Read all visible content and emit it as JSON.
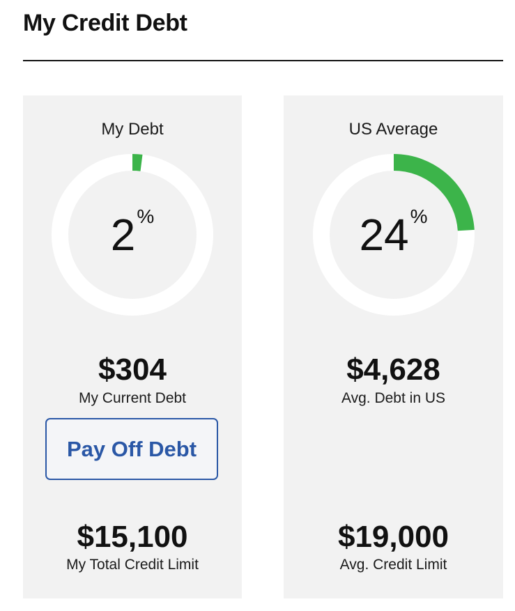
{
  "page": {
    "title": "My Credit Debt"
  },
  "colors": {
    "ring_track": "#ffffff",
    "ring_fill": "#3cb44a",
    "button_blue": "#2a57a6"
  },
  "my_debt": {
    "heading": "My Debt",
    "percent": 2,
    "percent_label": "2",
    "percent_sign": "%",
    "current_debt": "$304",
    "current_debt_label": "My Current Debt",
    "button_label": "Pay Off Debt",
    "credit_limit": "$15,100",
    "credit_limit_label": "My Total Credit Limit"
  },
  "us_average": {
    "heading": "US Average",
    "percent": 24,
    "percent_label": "24",
    "percent_sign": "%",
    "avg_debt": "$4,628",
    "avg_debt_label": "Avg. Debt in US",
    "credit_limit": "$19,000",
    "credit_limit_label": "Avg. Credit Limit"
  }
}
